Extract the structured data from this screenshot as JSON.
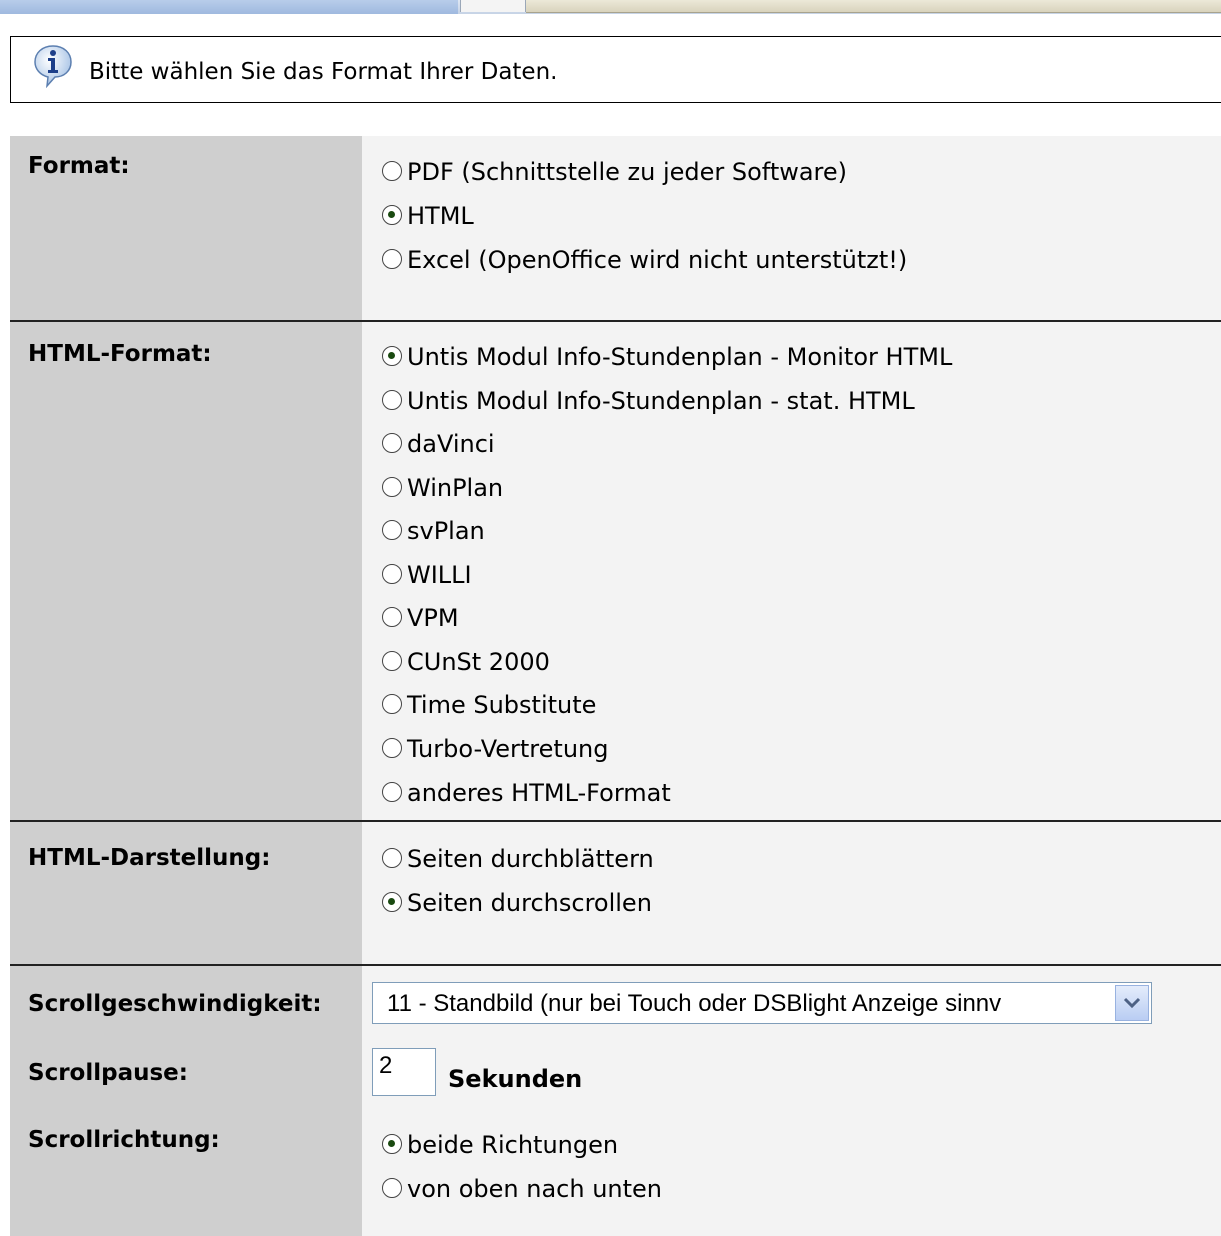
{
  "info": {
    "message": "Bitte wählen Sie das Format Ihrer Daten."
  },
  "format": {
    "label": "Format:",
    "options": [
      {
        "label": "PDF (Schnittstelle zu jeder Software)",
        "checked": false
      },
      {
        "label": "HTML",
        "checked": true
      },
      {
        "label": "Excel (OpenOffice wird nicht unterstützt!)",
        "checked": false
      }
    ]
  },
  "html_format": {
    "label": "HTML-Format:",
    "options": [
      {
        "label": "Untis Modul Info-Stundenplan - Monitor HTML",
        "checked": true
      },
      {
        "label": "Untis Modul Info-Stundenplan - stat. HTML",
        "checked": false
      },
      {
        "label": "daVinci",
        "checked": false
      },
      {
        "label": "WinPlan",
        "checked": false
      },
      {
        "label": "svPlan",
        "checked": false
      },
      {
        "label": "WILLI",
        "checked": false
      },
      {
        "label": "VPM",
        "checked": false
      },
      {
        "label": "CUnSt 2000",
        "checked": false
      },
      {
        "label": "Time Substitute",
        "checked": false
      },
      {
        "label": "Turbo-Vertretung",
        "checked": false
      },
      {
        "label": "anderes HTML-Format",
        "checked": false
      }
    ]
  },
  "html_display": {
    "label": "HTML-Darstellung:",
    "options": [
      {
        "label": "Seiten durchblättern",
        "checked": false
      },
      {
        "label": "Seiten durchscrollen",
        "checked": true
      }
    ]
  },
  "scroll_speed": {
    "label": "Scrollgeschwindigkeit:",
    "selected": "11 - Standbild (nur bei Touch oder DSBlight Anzeige sinnv"
  },
  "scroll_pause": {
    "label": "Scrollpause:",
    "value": "2",
    "unit": "Sekunden"
  },
  "scroll_direction": {
    "label": "Scrollrichtung:",
    "options": [
      {
        "label": "beide Richtungen",
        "checked": true
      },
      {
        "label": "von oben nach unten",
        "checked": false
      }
    ]
  }
}
